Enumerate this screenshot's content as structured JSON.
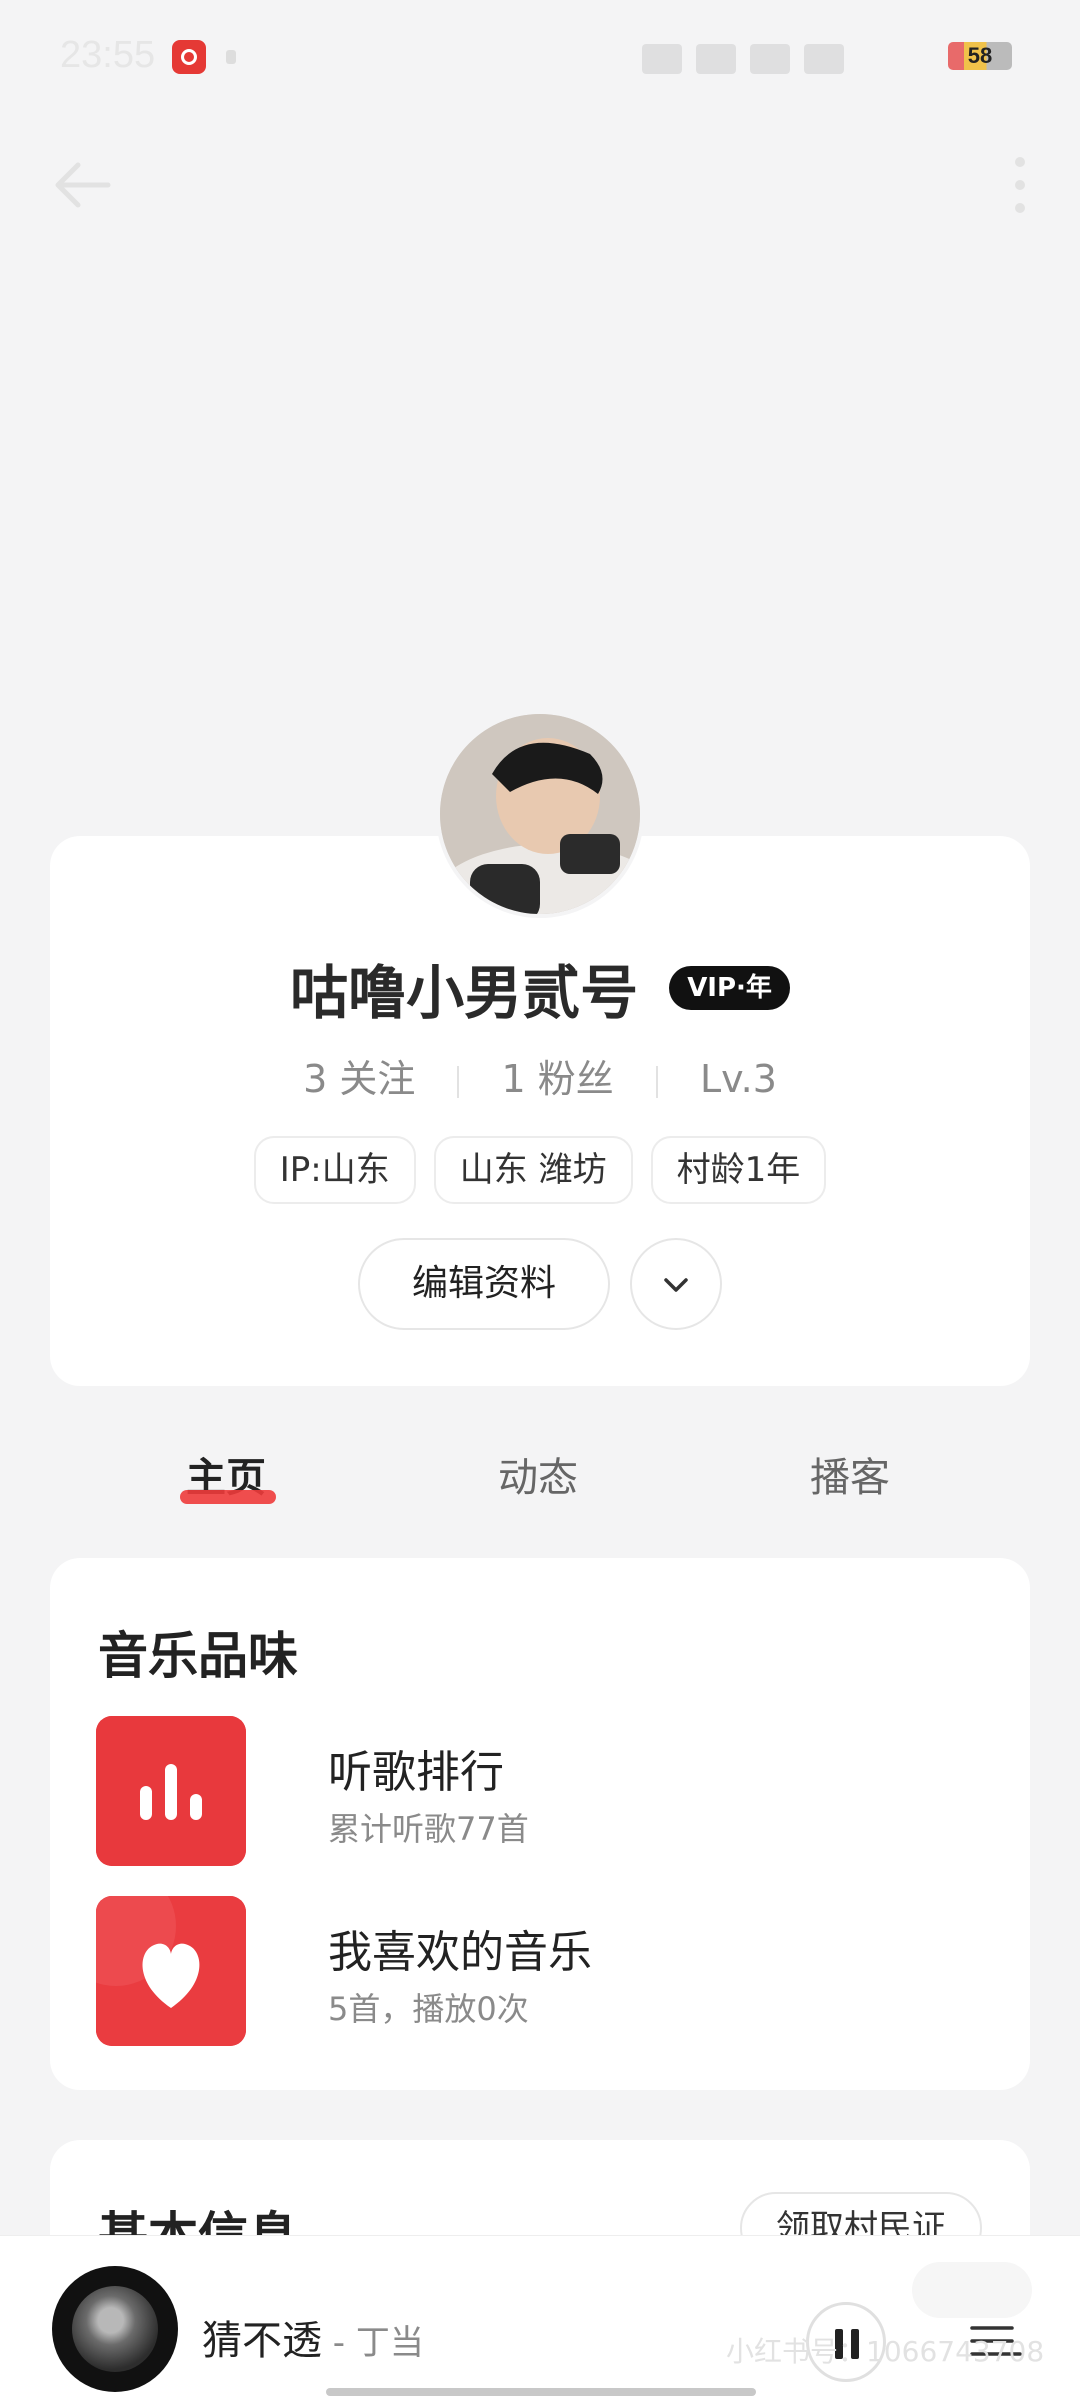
{
  "status_bar": {
    "time": "23:55",
    "battery": "58"
  },
  "nav": {
    "back_icon": "arrow-left-icon",
    "more_icon": "more-vertical-icon"
  },
  "profile": {
    "username": "咕噜小男贰号",
    "vip_badge": "VIP·年",
    "stats": {
      "following": "3 关注",
      "followers": "1 粉丝",
      "level": "Lv.3"
    },
    "tags": [
      "IP:山东",
      "山东 潍坊",
      "村龄1年"
    ],
    "edit_button": "编辑资料"
  },
  "tabs": [
    "主页",
    "动态",
    "播客"
  ],
  "active_tab": "主页",
  "music_taste": {
    "title": "音乐品味",
    "items": [
      {
        "name": "听歌排行",
        "sub": "累计听歌77首",
        "icon": "bar-chart-icon"
      },
      {
        "name": "我喜欢的音乐",
        "sub": "5首，播放0次",
        "icon": "heart-icon"
      }
    ]
  },
  "basic_info": {
    "title": "基本信息",
    "button": "领取村民证"
  },
  "player": {
    "song": "猜不透",
    "artist": " - 丁当",
    "watermark": "小红书号：1066743708"
  },
  "colors": {
    "accent": "#ee3b3b",
    "background": "#f4f4f5",
    "card": "#ffffff"
  }
}
